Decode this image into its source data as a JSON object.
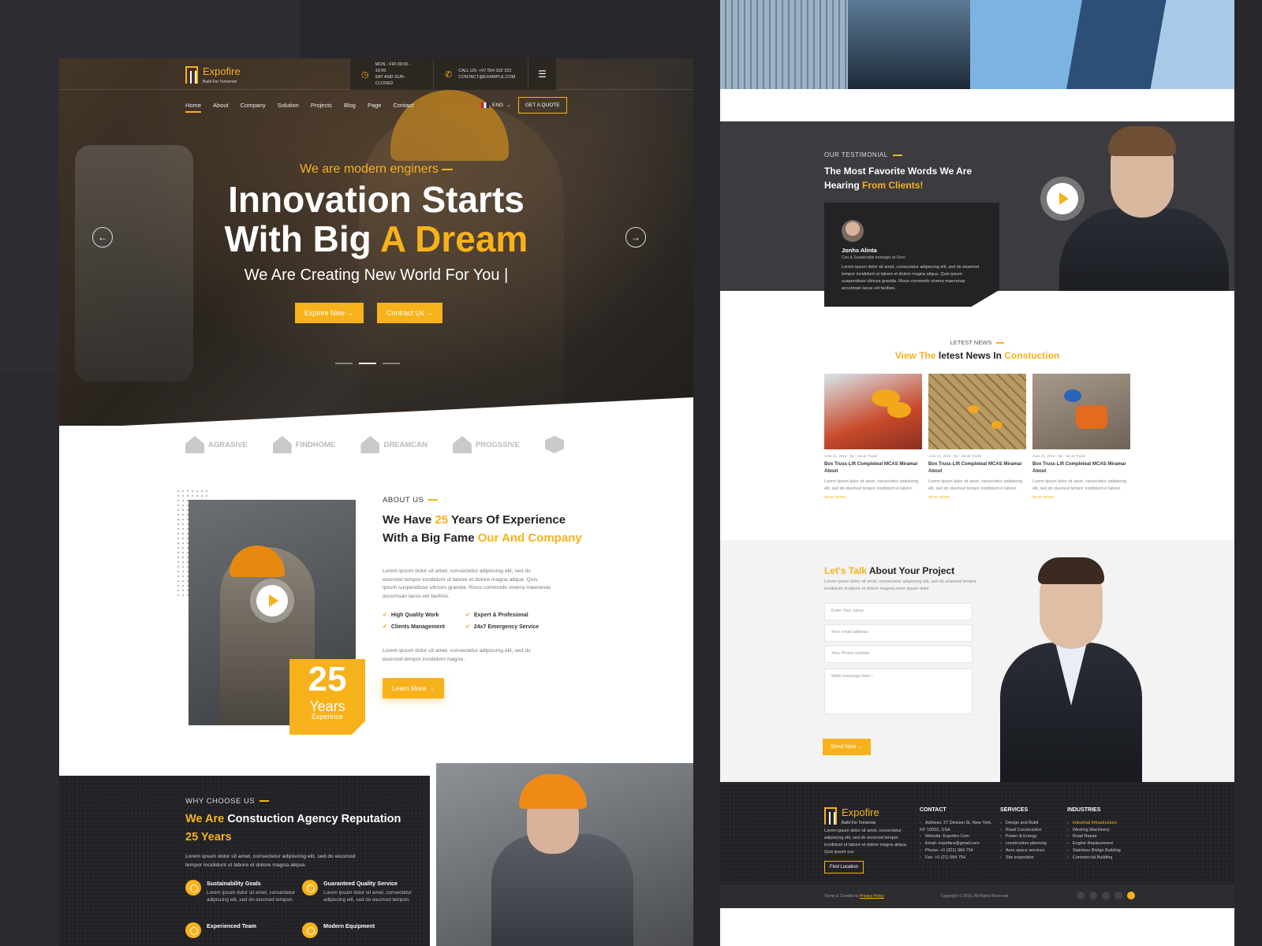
{
  "left": {
    "logo": {
      "name": "Expofire",
      "tagline": "Build For Tomorrow"
    },
    "topbar": {
      "hours_line1": "MON - FRI 09:00 - 19:00",
      "hours_line2": "SAT AND SUN - CLOSED",
      "call_line1": "CALL US: +07 554 332 322",
      "call_line2": "CONTACT@EXAMPLE.COM"
    },
    "nav": [
      "Home",
      "About",
      "Company",
      "Solution",
      "Projects",
      "Blog",
      "Page",
      "Contact"
    ],
    "lang": "ENG",
    "quote_button": "GET A QUOTE",
    "hero": {
      "tag": "We are modern enginers",
      "title_line1": "Innovation Starts",
      "title_line2a": "With Big",
      "title_line2b": "A Dream",
      "subtitle": "We Are Creating New  World For You |",
      "btn_explore": "Explore Now →",
      "btn_contact": "Contract Us →"
    },
    "partners": [
      "AGRASIVE",
      "FINDHOME",
      "DREAMCAN",
      "PROGSSIVE"
    ],
    "about": {
      "kicker": "ABOUT US",
      "h_a": "We Have",
      "h_b": "25",
      "h_c": "Years Of Experience With a Big Fame",
      "h_d": "Our And Company",
      "p1": "Lorem ipsum dolor sit amet, consectetur adipiscing elit, sed do eiusmod tempor incididunt ut labore et dolore magna aliqua. Quis ipsum suspendisse ultrices gravida. Risus commodo viverra maecenas accumsan lacus vel facilisis.",
      "checks": [
        "High Quality Work",
        "Expert & Profesional",
        "Clients Management",
        "24x7 Emergency Service"
      ],
      "p2": "Lorem ipsum dolor sit amet, consectetur adipiscing elit, sed do eiusmod tempor incididunt magna .",
      "learn": "Learn More →",
      "years_num": "25",
      "years_label": "Years",
      "years_sub": "Experince"
    },
    "why": {
      "kicker": "WHY CHOOSE US",
      "h_a": "We Are",
      "h_b": "Constuction Agency Reputation",
      "h_c": "25 Years",
      "p": "Lorem ipsum dolor sit amet, consectetur adipiscing elit, sed do eiusmod tempor incididunt ut labore et dolore magna aliqua.",
      "features": [
        {
          "title": "Sustainability Goals",
          "text": "Lorem ipsum dolor sit amet, consectetur adipiscing elit, sed do eiusmod tempori."
        },
        {
          "title": "Guaranteed Quality Service",
          "text": "Lorem ipsum dolor sit amet, consectetur adipiscing elit, sed do eiusmod tempori."
        },
        {
          "title": "Experienced Team",
          "text": ""
        },
        {
          "title": "Modern Equipment",
          "text": ""
        }
      ]
    }
  },
  "right": {
    "testimonial": {
      "kicker": "OUR TESTIMONIAL",
      "h_a": "The Most Favorite Words We Are Hearing",
      "h_b": "From Clients!",
      "name": "Jonhs Alinta",
      "role": "Ceo & Sustainable manager at Oreo",
      "quote": "Lorem ipsum dolor sit amet, consectetur adipiscing elit, sed do eiusmod tempor incididunt ut labore et dolore magna aliqua. Quis ipsum suspendisse ultrices gravida. Risus commodo viverra maecenas accumsan lacus vel facilisis."
    },
    "news": {
      "kicker": "LETEST NEWS",
      "h_a": "View The",
      "h_b": "letest News In",
      "h_c": "Constuction",
      "items": [
        {
          "meta": "June 21, 2018 - By : Jacob Trader",
          "title": "Box Truss Lift Completeat MCAS Miramar About",
          "text": "Lorem ipsum dolor sit amet, consectetur adipiscing elit, sed do eiusmod tempor incididunt ut labore .",
          "more": "READ MORE"
        },
        {
          "meta": "June 21, 2018 - By : Jacob Trader",
          "title": "Box Truss Lift Completeat MCAS Miramar About",
          "text": "Lorem ipsum dolor sit amet, consectetur adipiscing elit, sed do eiusmod tempor incididunt ut labore .",
          "more": "READ MORE"
        },
        {
          "meta": "June 21, 2018 - By : Jacob Trader",
          "title": "Box Truss Lift Completeat MCAS Miramar About",
          "text": "Lorem ipsum dolor sit amet, consectetur adipiscing elit, sed do eiusmod tempor incididunt ut labore .",
          "more": "READ MORE"
        }
      ]
    },
    "talk": {
      "h_a": "Let's Talk",
      "h_b": "About Your Project",
      "p": "Lorem ipsum dolor sit amet, consectetur adipiscing elit, sed do eiusmod tempor incididunt ut labore et dolore magnaLorem ipsum dolor",
      "placeholders": {
        "name": "Enter Your name",
        "email": "Your email address",
        "phone": "Your Phone number",
        "message": "Write message here !"
      },
      "send": "Send Now →"
    },
    "footer": {
      "logo_name": "Expofire",
      "logo_tag": "Build For Tomorrow",
      "about": "Lorem ipsum dolor sit amet, consectetur adipiscing elit, sed do eiusmod tempor incididunt ut labore et dolore magna aliqua. Quis ipsum sus",
      "find": "Find Location",
      "contact_h": "CONTACT",
      "contact": [
        "Address: 27 Division St, New York, NY 10002, USA",
        "Website: Expofire.Com",
        "Email: expofare@gmail.com",
        "Phone: +0 (321) 984 754",
        "Fax: +0 (21) 984 754"
      ],
      "services_h": "SERVICES",
      "services": [
        "Design and Build",
        "Road Construction",
        "Power & Energy",
        "construction planning",
        "Aero space services",
        "Site inspection"
      ],
      "industries_h": "INDUSTRIES",
      "industries": [
        "Industrial Infrastructure",
        "Wireling Machinery",
        "Road Repair",
        "Engine Replacement",
        "Stainless Bridge Building",
        "Commercial Building"
      ],
      "terms": "Terms & Conditions",
      "privacy": "Privacy Policy",
      "copyright": "Copyright © 2019, All Rights Reserved"
    }
  },
  "colors": {
    "accent": "#f7b21b",
    "dark": "#222226",
    "page_bg": "#27272c"
  }
}
